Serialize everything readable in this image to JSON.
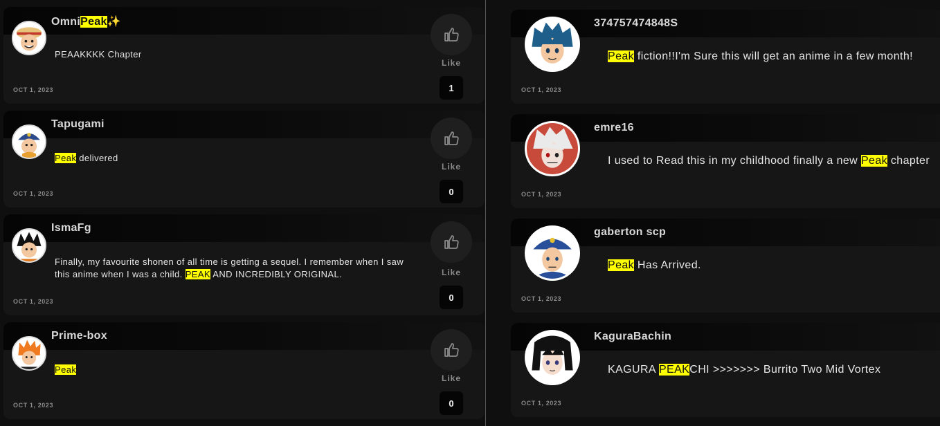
{
  "left_comments": [
    {
      "username_parts": [
        "Omni",
        "Peak",
        "✨"
      ],
      "text_parts": [
        {
          "t": "PEAAKKKK Chapter",
          "hl": false
        }
      ],
      "date": "OCT 1, 2023",
      "like_label": "Like",
      "like_count": "1",
      "avatar": "luffy-avatar"
    },
    {
      "username_parts": [
        "Tapugami"
      ],
      "text_parts": [
        {
          "t": "Peak",
          "hl": true
        },
        {
          "t": " delivered",
          "hl": false
        }
      ],
      "date": "OCT 1, 2023",
      "like_label": "Like",
      "like_count": "0",
      "avatar": "jotaro-kid-avatar"
    },
    {
      "username_parts": [
        "IsmaFg"
      ],
      "text_parts": [
        {
          "t": "Finally, my favourite shonen of all time is getting a sequel. I remember when I saw this anime when I was a child. ",
          "hl": false
        },
        {
          "t": "PEAK",
          "hl": true
        },
        {
          "t": " AND INCREDIBLY ORIGINAL.",
          "hl": false
        }
      ],
      "date": "OCT 1, 2023",
      "like_label": "Like",
      "like_count": "0",
      "avatar": "goku-avatar"
    },
    {
      "username_parts": [
        "Prime-box"
      ],
      "text_parts": [
        {
          "t": "Peak",
          "hl": true
        }
      ],
      "date": "OCT 1, 2023",
      "like_label": "Like",
      "like_count": "0",
      "avatar": "ichigo-avatar"
    }
  ],
  "right_comments": [
    {
      "username": "374757474848S",
      "text_parts": [
        {
          "t": "Peak",
          "hl": true
        },
        {
          "t": " fiction!!I'm Sure this will get an anime in a few month!",
          "hl": false
        }
      ],
      "date": "OCT 1, 2023",
      "avatar": "blue-hair-avatar"
    },
    {
      "username": "emre16",
      "text_parts": [
        {
          "t": "I used to Read this in my childhood finally a new ",
          "hl": false
        },
        {
          "t": "Peak",
          "hl": true
        },
        {
          "t": " chapter",
          "hl": false
        }
      ],
      "date": "OCT 1, 2023",
      "avatar": "white-hair-avatar"
    },
    {
      "username": "gaberton scp",
      "text_parts": [
        {
          "t": "Peak",
          "hl": true
        },
        {
          "t": " Has Arrived.",
          "hl": false
        }
      ],
      "date": "OCT 1, 2023",
      "avatar": "jotaro-avatar"
    },
    {
      "username": "KaguraBachin",
      "text_parts": [
        {
          "t": "KAGURA ",
          "hl": false
        },
        {
          "t": "PEAK",
          "hl": true
        },
        {
          "t": "CHI >>>>>>> Burrito Two Mid Vortex",
          "hl": false
        }
      ],
      "date": "OCT 1, 2023",
      "avatar": "rukia-avatar"
    }
  ],
  "colors": {
    "highlight": "#ffff00",
    "card_bg": "#161616",
    "page_bg": "#0f0f0f"
  }
}
